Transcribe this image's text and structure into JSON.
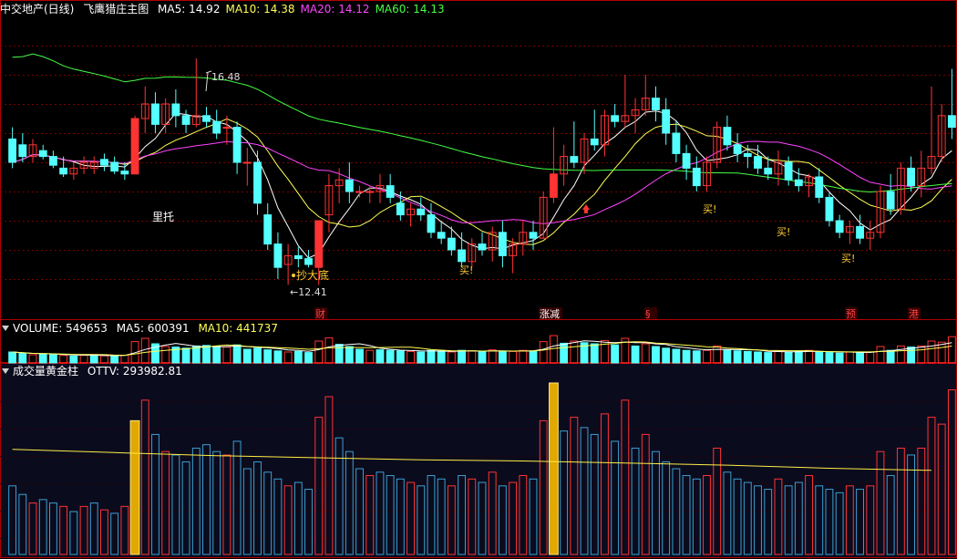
{
  "main": {
    "stock": "中交地产(日线)",
    "indicator": "飞鹰猎庄主图",
    "ma_items": [
      {
        "label": "MA5: 14.92",
        "color": "#ffffff"
      },
      {
        "label": "MA10: 14.38",
        "color": "#ffff55"
      },
      {
        "label": "MA20: 14.12",
        "color": "#ff44ff"
      },
      {
        "label": "MA60: 14.13",
        "color": "#44ff44"
      }
    ],
    "high_label": "16.48",
    "low_label": "←12.41",
    "signals": [
      "里托",
      "抄大底",
      "买!",
      "买!",
      "买!",
      "买!"
    ],
    "events": [
      "财",
      "涨减",
      "§",
      "预",
      "港"
    ]
  },
  "volume": {
    "title": "VOLUME: 549653",
    "ma5": "MA5: 600391",
    "ma10": "MA10: 441737"
  },
  "ottv": {
    "title": "成交量黄金柱",
    "value": "OTTV: 293982.81"
  },
  "colors": {
    "up": "#ff3333",
    "down": "#54ffff",
    "grid": "#7a0000",
    "border": "#b00000"
  },
  "chart_data": {
    "type": "candlestick",
    "price_range": [
      12.2,
      17.2
    ],
    "candles": [
      [
        15.1,
        15.3,
        14.6,
        14.7
      ],
      [
        15.0,
        15.2,
        14.7,
        14.8
      ],
      [
        14.8,
        15.1,
        14.7,
        15.0
      ],
      [
        14.9,
        15.0,
        14.75,
        14.8
      ],
      [
        14.8,
        14.9,
        14.6,
        14.65
      ],
      [
        14.6,
        14.8,
        14.45,
        14.5
      ],
      [
        14.5,
        14.7,
        14.4,
        14.6
      ],
      [
        14.6,
        14.8,
        14.5,
        14.7
      ],
      [
        14.6,
        14.8,
        14.5,
        14.7
      ],
      [
        14.75,
        14.85,
        14.55,
        14.65
      ],
      [
        14.7,
        14.8,
        14.5,
        14.55
      ],
      [
        14.55,
        14.7,
        14.4,
        14.5
      ],
      [
        14.5,
        15.5,
        14.5,
        15.45
      ],
      [
        15.45,
        16.0,
        15.2,
        15.7
      ],
      [
        15.7,
        15.9,
        15.2,
        15.35
      ],
      [
        15.35,
        15.8,
        15.2,
        15.7
      ],
      [
        15.7,
        15.95,
        15.3,
        15.5
      ],
      [
        15.5,
        15.6,
        15.2,
        15.35
      ],
      [
        15.35,
        16.48,
        15.3,
        15.5
      ],
      [
        15.5,
        15.65,
        15.3,
        15.4
      ],
      [
        15.4,
        15.6,
        15.1,
        15.2
      ],
      [
        15.3,
        15.5,
        15.0,
        15.3
      ],
      [
        15.3,
        15.4,
        14.5,
        14.7
      ],
      [
        14.7,
        14.95,
        14.3,
        14.7
      ],
      [
        14.7,
        14.9,
        13.8,
        14.0
      ],
      [
        13.8,
        14.0,
        13.2,
        13.3
      ],
      [
        13.3,
        13.5,
        12.7,
        12.9
      ],
      [
        12.95,
        13.3,
        12.6,
        13.1
      ],
      [
        13.1,
        13.25,
        12.9,
        13.05
      ],
      [
        13.05,
        13.2,
        12.9,
        12.95
      ],
      [
        12.9,
        13.7,
        12.6,
        13.7
      ],
      [
        13.8,
        14.5,
        13.5,
        14.3
      ],
      [
        14.3,
        14.6,
        14.0,
        14.4
      ],
      [
        14.4,
        14.7,
        14.0,
        14.2
      ],
      [
        14.2,
        14.3,
        14.1,
        14.2
      ],
      [
        14.2,
        14.3,
        14.0,
        14.2
      ],
      [
        14.2,
        14.5,
        14.0,
        14.3
      ],
      [
        14.3,
        14.5,
        14.0,
        14.1
      ],
      [
        14.0,
        14.2,
        13.7,
        13.8
      ],
      [
        13.8,
        14.0,
        13.6,
        13.9
      ],
      [
        13.9,
        14.1,
        13.7,
        13.8
      ],
      [
        13.8,
        14.0,
        13.4,
        13.5
      ],
      [
        13.5,
        13.7,
        13.3,
        13.4
      ],
      [
        13.4,
        13.6,
        13.1,
        13.2
      ],
      [
        13.2,
        13.5,
        12.9,
        13.0
      ],
      [
        13.0,
        13.4,
        12.9,
        13.3
      ],
      [
        13.3,
        13.5,
        13.1,
        13.2
      ],
      [
        13.2,
        13.6,
        13.0,
        13.5
      ],
      [
        13.5,
        13.7,
        12.9,
        13.1
      ],
      [
        13.1,
        13.4,
        12.8,
        13.3
      ],
      [
        13.3,
        13.7,
        13.1,
        13.5
      ],
      [
        13.5,
        13.7,
        13.2,
        13.4
      ],
      [
        13.4,
        14.2,
        13.4,
        14.1
      ],
      [
        14.1,
        15.3,
        14.0,
        14.5
      ],
      [
        14.5,
        15.0,
        14.3,
        14.8
      ],
      [
        14.8,
        15.4,
        14.6,
        14.7
      ],
      [
        14.7,
        15.2,
        14.5,
        15.1
      ],
      [
        15.1,
        15.6,
        14.9,
        15.0
      ],
      [
        15.0,
        15.6,
        14.8,
        15.5
      ],
      [
        15.5,
        15.7,
        15.3,
        15.4
      ],
      [
        15.4,
        16.2,
        15.3,
        15.5
      ],
      [
        15.5,
        15.8,
        15.2,
        15.6
      ],
      [
        15.6,
        16.2,
        15.5,
        15.8
      ],
      [
        15.8,
        16.0,
        15.4,
        15.6
      ],
      [
        15.6,
        15.8,
        15.0,
        15.2
      ],
      [
        15.2,
        15.4,
        14.7,
        14.85
      ],
      [
        14.85,
        15.0,
        14.4,
        14.6
      ],
      [
        14.6,
        14.8,
        14.2,
        14.3
      ],
      [
        14.3,
        14.8,
        14.2,
        14.7
      ],
      [
        14.7,
        15.4,
        14.6,
        15.3
      ],
      [
        15.3,
        15.5,
        14.9,
        15.0
      ],
      [
        15.0,
        15.2,
        14.7,
        14.85
      ],
      [
        14.85,
        15.0,
        14.6,
        14.8
      ],
      [
        14.8,
        15.0,
        14.5,
        14.6
      ],
      [
        14.6,
        14.8,
        14.4,
        14.5
      ],
      [
        14.5,
        14.9,
        14.3,
        14.7
      ],
      [
        14.7,
        14.8,
        14.3,
        14.4
      ],
      [
        14.4,
        14.6,
        14.2,
        14.3
      ],
      [
        14.3,
        14.5,
        14.1,
        14.45
      ],
      [
        14.45,
        14.6,
        14.0,
        14.1
      ],
      [
        14.1,
        14.2,
        13.6,
        13.7
      ],
      [
        13.7,
        13.8,
        13.4,
        13.5
      ],
      [
        13.5,
        13.7,
        13.3,
        13.6
      ],
      [
        13.6,
        13.8,
        13.3,
        13.4
      ],
      [
        13.4,
        13.7,
        13.2,
        13.5
      ],
      [
        13.5,
        14.3,
        13.4,
        14.2
      ],
      [
        14.2,
        14.5,
        13.8,
        13.9
      ],
      [
        13.9,
        14.7,
        13.8,
        14.6
      ],
      [
        14.6,
        14.8,
        14.2,
        14.3
      ],
      [
        14.3,
        14.9,
        14.1,
        14.6
      ],
      [
        14.6,
        16.0,
        14.5,
        14.8
      ],
      [
        14.8,
        15.7,
        14.7,
        15.5
      ],
      [
        15.5,
        16.3,
        15.1,
        15.3
      ]
    ],
    "volume": [
      [
        40,
        1
      ],
      [
        35,
        1
      ],
      [
        30,
        0
      ],
      [
        32,
        1
      ],
      [
        30,
        1
      ],
      [
        28,
        0
      ],
      [
        25,
        1
      ],
      [
        28,
        0
      ],
      [
        30,
        1
      ],
      [
        26,
        0
      ],
      [
        24,
        1
      ],
      [
        28,
        0
      ],
      [
        78,
        0
      ],
      [
        90,
        0
      ],
      [
        70,
        1
      ],
      [
        60,
        0
      ],
      [
        58,
        1
      ],
      [
        54,
        1
      ],
      [
        62,
        1
      ],
      [
        64,
        1
      ],
      [
        60,
        1
      ],
      [
        58,
        0
      ],
      [
        66,
        1
      ],
      [
        50,
        1
      ],
      [
        54,
        1
      ],
      [
        48,
        1
      ],
      [
        44,
        1
      ],
      [
        40,
        0
      ],
      [
        42,
        1
      ],
      [
        38,
        1
      ],
      [
        80,
        0
      ],
      [
        92,
        0
      ],
      [
        68,
        1
      ],
      [
        60,
        1
      ],
      [
        50,
        1
      ],
      [
        46,
        0
      ],
      [
        48,
        1
      ],
      [
        46,
        1
      ],
      [
        44,
        1
      ],
      [
        42,
        0
      ],
      [
        40,
        1
      ],
      [
        46,
        1
      ],
      [
        44,
        1
      ],
      [
        40,
        0
      ],
      [
        46,
        1
      ],
      [
        44,
        0
      ],
      [
        42,
        1
      ],
      [
        48,
        0
      ],
      [
        40,
        1
      ],
      [
        42,
        0
      ],
      [
        46,
        0
      ],
      [
        44,
        1
      ],
      [
        78,
        0
      ],
      [
        100,
        0
      ],
      [
        72,
        1
      ],
      [
        80,
        0
      ],
      [
        74,
        1
      ],
      [
        70,
        1
      ],
      [
        82,
        0
      ],
      [
        66,
        1
      ],
      [
        90,
        0
      ],
      [
        62,
        1
      ],
      [
        70,
        0
      ],
      [
        60,
        1
      ],
      [
        54,
        1
      ],
      [
        50,
        1
      ],
      [
        46,
        1
      ],
      [
        44,
        1
      ],
      [
        46,
        0
      ],
      [
        62,
        0
      ],
      [
        48,
        1
      ],
      [
        44,
        1
      ],
      [
        42,
        1
      ],
      [
        40,
        1
      ],
      [
        38,
        1
      ],
      [
        44,
        0
      ],
      [
        40,
        1
      ],
      [
        42,
        1
      ],
      [
        46,
        0
      ],
      [
        40,
        1
      ],
      [
        38,
        1
      ],
      [
        36,
        1
      ],
      [
        40,
        0
      ],
      [
        38,
        1
      ],
      [
        40,
        0
      ],
      [
        60,
        0
      ],
      [
        46,
        1
      ],
      [
        62,
        0
      ],
      [
        58,
        1
      ],
      [
        62,
        0
      ],
      [
        80,
        0
      ],
      [
        76,
        0
      ],
      [
        96,
        0
      ]
    ],
    "ottv_line": [
      [
        0,
        1.0
      ],
      [
        10,
        0.97
      ],
      [
        20,
        0.94
      ],
      [
        30,
        0.92
      ],
      [
        40,
        0.9
      ],
      [
        50,
        0.89
      ],
      [
        60,
        0.87
      ],
      [
        70,
        0.85
      ],
      [
        80,
        0.82
      ],
      [
        90,
        0.8
      ]
    ]
  }
}
